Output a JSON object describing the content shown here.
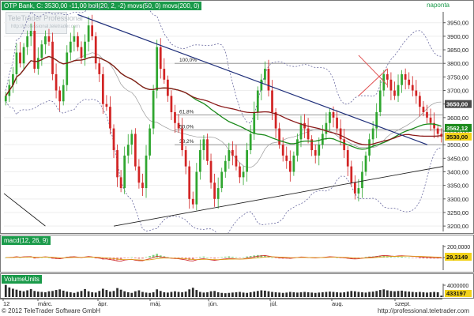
{
  "header": {
    "title": "OTP Bank, C: 3530,00 -11,00 boll(20, 2, -2) movs(50, 0) movs(200, 0)",
    "period": "napontа"
  },
  "watermark": {
    "title": "TeleTrader Professional",
    "subtitle": "http://professional.teletrader.com"
  },
  "colors": {
    "up": "#2fa62f",
    "down": "#d22424",
    "trend": "#1f2f7a",
    "ma50": "#1b8a1b",
    "ma20": "#8b1a1a",
    "boll": "#6a6aa0",
    "header": "#1a9a4a"
  },
  "price_axis": {
    "ticks": [
      3950,
      3900,
      3850,
      3800,
      3750,
      3700,
      3650,
      3600,
      3550,
      3500,
      3450,
      3400,
      3350,
      3300,
      3250,
      3200
    ],
    "tick_labels": [
      "3950,00",
      "3900,00",
      "3850,00",
      "3800,00",
      "3750,00",
      "3700,00",
      "3650,00",
      "3600,00",
      "3550,00",
      "3500,00",
      "3450,00",
      "3400,00",
      "3350,00",
      "3300,00",
      "3250,00",
      "3200,00"
    ],
    "markers": [
      {
        "label": "3650,00",
        "value": 3650,
        "bg": "#4a4a4a"
      },
      {
        "label": "3562,12",
        "value": 3562,
        "bg": "#1b8a1b"
      },
      {
        "label": "3530,00",
        "value": 3530,
        "bg": "#f2d21a"
      }
    ]
  },
  "fib_levels": [
    {
      "label": "100,0%",
      "value": 3800
    },
    {
      "label": "61,8%",
      "value": 3610
    },
    {
      "label": "50,0%",
      "value": 3555
    },
    {
      "label": "38,2%",
      "value": 3500
    }
  ],
  "macd": {
    "title": "macd(12, 26, 9)",
    "ticks": [
      "200,0000",
      "0,0000"
    ],
    "value_label": "29,3149"
  },
  "volume": {
    "title": "VolumeUnits",
    "ticks": [
      "4000000"
    ],
    "value_label": "433197"
  },
  "x_axis": {
    "labels": [
      "12",
      "márc.",
      "ápr.",
      "máj.",
      "jún.",
      "júl.",
      "aug.",
      "szept."
    ]
  },
  "footer": {
    "left": "© 2012 TeleTrader Software GmbH",
    "right": "http://professional.teletrader.com"
  },
  "chart_data": {
    "type": "candlestick",
    "title": "OTP Bank, C: 3530,00 -11,00 boll(20, 2, -2) movs(50, 0) movs(200, 0)",
    "ylim": [
      3180,
      3990
    ],
    "categories": [
      "márc.",
      "ápr.",
      "máj.",
      "jún.",
      "júl.",
      "aug.",
      "szept."
    ],
    "close": [
      3680,
      3720,
      3760,
      3840,
      3800,
      3860,
      3900,
      3920,
      3780,
      3820,
      3870,
      3900,
      3880,
      3760,
      3700,
      3660,
      3720,
      3840,
      3880,
      3900,
      3860,
      3820,
      3880,
      3940,
      3900,
      3800,
      3760,
      3650,
      3640,
      3560,
      3480,
      3380,
      3340,
      3460,
      3500,
      3540,
      3420,
      3360,
      3340,
      3460,
      3560,
      3700,
      3860,
      3780,
      3740,
      3680,
      3620,
      3580,
      3560,
      3480,
      3420,
      3300,
      3280,
      3400,
      3480,
      3520,
      3440,
      3360,
      3300,
      3340,
      3400,
      3440,
      3480,
      3460,
      3420,
      3380,
      3400,
      3480,
      3540,
      3620,
      3700,
      3740,
      3780,
      3700,
      3620,
      3560,
      3500,
      3460,
      3440,
      3400,
      3460,
      3520,
      3580,
      3560,
      3520,
      3480,
      3460,
      3500,
      3540,
      3580,
      3620,
      3600,
      3560,
      3520,
      3480,
      3420,
      3360,
      3320,
      3340,
      3400,
      3460,
      3520,
      3560,
      3620,
      3700,
      3760,
      3740,
      3700,
      3680,
      3720,
      3760,
      3740,
      3720,
      3700,
      3680,
      3640,
      3620,
      3600,
      3580,
      3560,
      3540,
      3530
    ],
    "volume": [
      3800000,
      3000000,
      2600000,
      2300000,
      2000000,
      1800000,
      2100000,
      2500000,
      1900000,
      1700000,
      1600000,
      1500000,
      1800000,
      1900000,
      2200000,
      2400000,
      2000000,
      1700000,
      1500000,
      1300000,
      1600000,
      1900000,
      2500000,
      1800000,
      1500000,
      1400000,
      1900000,
      2600000,
      2200000,
      1700000,
      1900000,
      2800000,
      2300000,
      1800000,
      1500000,
      1300000,
      1800000,
      2100000,
      1600000,
      1400000,
      1300000,
      1500000,
      2400000,
      1900000,
      1500000,
      1400000,
      1600000,
      1800000,
      1600000,
      1500000,
      1700000,
      2400000,
      2900000,
      2200000,
      1600000,
      1400000,
      1500000,
      1800000,
      1900000,
      1500000,
      1300000,
      1200000,
      1300000,
      1400000,
      1500000,
      1600000,
      1400000,
      1300000,
      1500000,
      1700000,
      1900000,
      2100000,
      2000000,
      1800000,
      1600000,
      1500000,
      1400000,
      1300000,
      1400000,
      1600000,
      1500000,
      1400000,
      1500000,
      1600000,
      1500000,
      1400000,
      1300000,
      1400000,
      1500000,
      1600000,
      1700000,
      1600000,
      1500000,
      1400000,
      1500000,
      1700000,
      1900000,
      1800000,
      1600000,
      1500000,
      1400000,
      1600000,
      1700000,
      1900000,
      2200000,
      2400000,
      2100000,
      1900000,
      1800000,
      1900000,
      2000000,
      1800000,
      1700000,
      1600000,
      1500000,
      1600000,
      1500000,
      1400000,
      1500000,
      1600000,
      1500000,
      433197
    ]
  }
}
